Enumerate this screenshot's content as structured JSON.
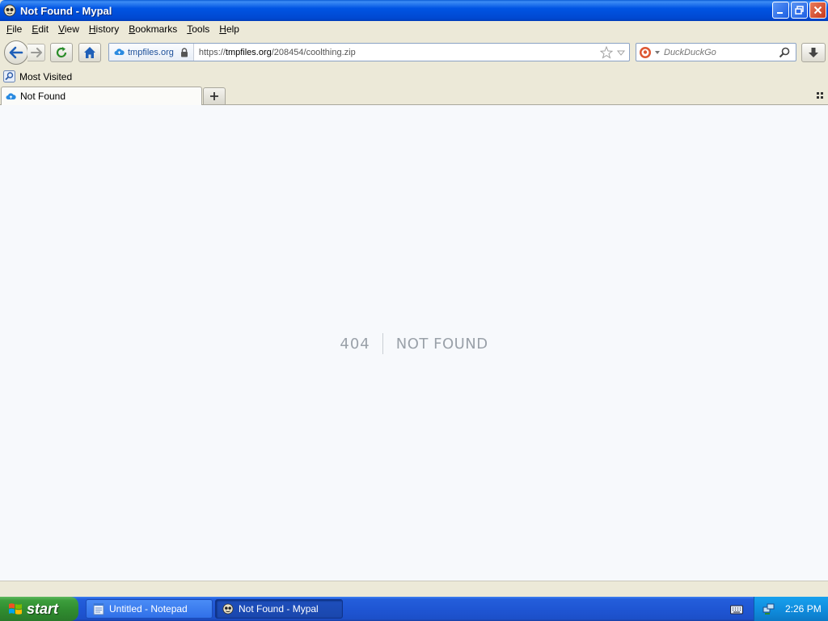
{
  "window": {
    "title": "Not Found - Mypal"
  },
  "menu": {
    "items": [
      {
        "label": "File",
        "accel": "F",
        "rest": "ile"
      },
      {
        "label": "Edit",
        "accel": "E",
        "rest": "dit"
      },
      {
        "label": "View",
        "accel": "V",
        "rest": "iew"
      },
      {
        "label": "History",
        "accel": "H",
        "rest": "istory"
      },
      {
        "label": "Bookmarks",
        "accel": "B",
        "rest": "ookmarks"
      },
      {
        "label": "Tools",
        "accel": "T",
        "rest": "ools"
      },
      {
        "label": "Help",
        "accel": "H",
        "rest": "elp"
      }
    ]
  },
  "urlbar": {
    "identity_host": "tmpfiles.org",
    "url_scheme": "https://",
    "url_domain": "tmpfiles.org",
    "url_path": "/208454/coolthing.zip"
  },
  "search": {
    "placeholder": "DuckDuckGo"
  },
  "bookmarks": {
    "most_visited": "Most Visited"
  },
  "tabs": {
    "active_label": "Not Found"
  },
  "page": {
    "code": "404",
    "message": "NOT FOUND"
  },
  "taskbar": {
    "start_label": "start",
    "tasks": [
      {
        "label": "Untitled - Notepad"
      },
      {
        "label": "Not Found - Mypal"
      }
    ],
    "clock": "2:26 PM"
  }
}
